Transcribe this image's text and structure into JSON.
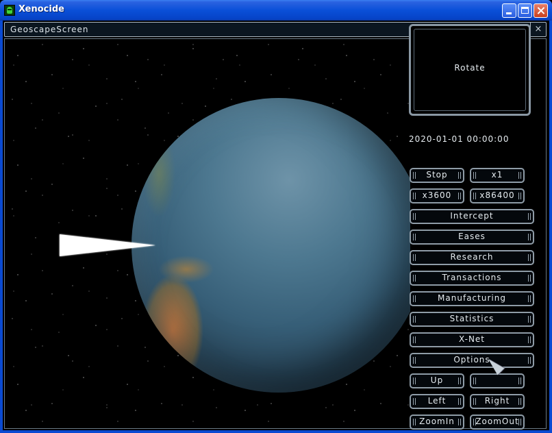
{
  "window": {
    "title": "Xenocide",
    "icon": "alien-icon"
  },
  "screen": {
    "title": "GeoscapeScreen",
    "close_glyph": "×"
  },
  "globe_panel": {
    "label": "Rotate"
  },
  "clock": {
    "datetime": "2020-01-01 00:00:00"
  },
  "time_controls": {
    "stop": "Stop",
    "x1": "x1",
    "x3600": "x3600",
    "x86400": "x86400"
  },
  "menu": {
    "items": [
      {
        "label": "Intercept"
      },
      {
        "label": "Eases"
      },
      {
        "label": "Research"
      },
      {
        "label": "Transactions"
      },
      {
        "label": "Manufacturing"
      },
      {
        "label": "Statistics"
      },
      {
        "label": "X-Net"
      },
      {
        "label": "Options"
      }
    ]
  },
  "camera": {
    "up": "Up",
    "down": "",
    "left": "Left",
    "right": "Right",
    "zoom_in": "ZoomIn",
    "zoom_out": "ZoomOut"
  },
  "colors": {
    "xp_blue": "#0a50d8",
    "button_border": "#8f9ca7",
    "text": "#e6ecf0"
  }
}
